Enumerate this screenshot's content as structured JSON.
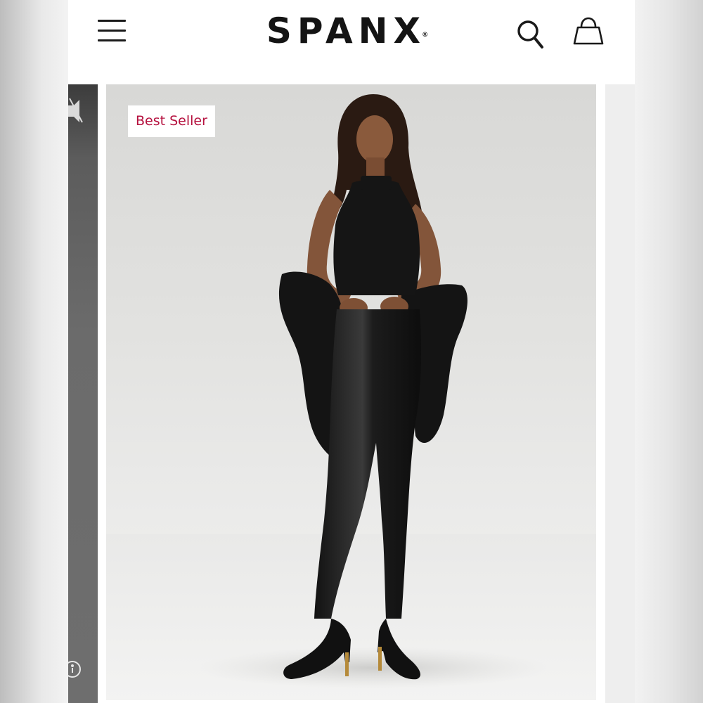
{
  "header": {
    "brand": "SPANX",
    "brand_mark": "®",
    "icons": {
      "menu": "hamburger-menu-icon",
      "search": "search-icon",
      "bag": "shopping-bag-icon"
    }
  },
  "product": {
    "badge": "Best Seller",
    "image": "model-wearing-faux-leather-leggings"
  },
  "colors": {
    "badge_text": "#b5103e",
    "text": "#141414",
    "background": "#ffffff"
  }
}
